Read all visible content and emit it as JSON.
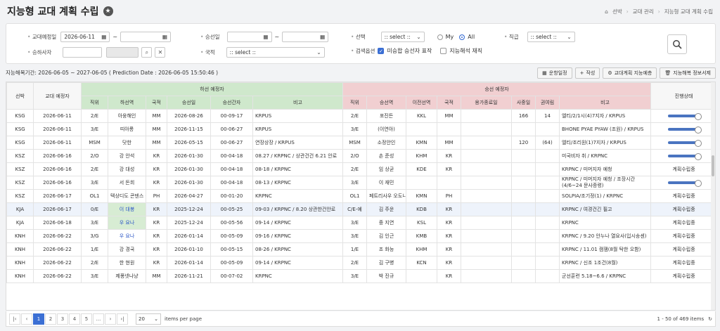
{
  "page": {
    "title": "지능형 교대 계획 수립",
    "breadcrumb": [
      "선박",
      "교대 관리",
      "지능형 교대 계획 수립"
    ]
  },
  "filter": {
    "plan_date_label": "교대예정일",
    "plan_date_from": "2026-06-11",
    "plan_date_to": "",
    "boarding_port_label": "승선일",
    "boarding_from": "",
    "boarding_to": "",
    "select_label": "선택",
    "select_value": ":: select ::",
    "radio_my": "My",
    "radio_all": "All",
    "rank_label": "직급",
    "rank_value": ":: select ::",
    "crew_label": "승하사자",
    "crew_value": "",
    "crew_value2": "",
    "nation_label": "국적",
    "nation_value": ":: select ::",
    "exclude_label": "검색옵션",
    "opt1": "미승합 승선자 표작",
    "opt2": "지능해석 재직"
  },
  "info": {
    "period": "지능해복기간: 2026-06-05 ~ 2027-06-05 ( Prediction Date : 2026-06-05 15:50:46 )"
  },
  "toolbar": {
    "btn1": "운항일정",
    "btn2": "작성",
    "btn3": "교대계획 지능예층",
    "btn4": "지능해복 정보서제"
  },
  "grid": {
    "h_select": "선박",
    "h_date": "교대 예정자",
    "h_off": "하선 예정자",
    "h_on": "승선 예정자",
    "h_status": "진행상태",
    "off_cols": [
      "직위",
      "하선역",
      "국적",
      "승선일",
      "승선간자",
      "비고"
    ],
    "on_cols": [
      "직위",
      "승선역",
      "이전선역",
      "국적",
      "용가종료일",
      "사중일",
      "권여림",
      "비고"
    ],
    "rows": [
      {
        "v": "KSG",
        "d": "2026-06-11",
        "r": "2/E",
        "n": "아웅해인",
        "c": "MM",
        "b": "2026-08-26",
        "p": "00-09-17",
        "note": "KRPUS",
        "r2": "2/E",
        "n2": "포진든",
        "pv": "KKL",
        "c2": "MM",
        "end": "",
        "s": "166",
        "k": "14",
        "note2": "엘티/2/1시(4)7지자 / KRPUS",
        "st": "bar"
      },
      {
        "v": "KSG",
        "d": "2026-06-11",
        "r": "3/E",
        "n": "띠아롱",
        "c": "MM",
        "b": "2026-11-15",
        "p": "00-06-27",
        "note": "KRPUS",
        "r2": "3/E",
        "n2": "(이연아)",
        "pv": "",
        "c2": "",
        "end": "",
        "s": "",
        "k": "",
        "note2": "BHONE PYAE PYAW (조원) / KRPUS",
        "st": "bar"
      },
      {
        "v": "KSG",
        "d": "2026-06-11",
        "r": "MSM",
        "n": "닷한",
        "c": "MM",
        "b": "2026-05-15",
        "p": "00-06-27",
        "note": "연장상장 / KRPUS",
        "r2": "MSM",
        "n2": "소정안인",
        "pv": "KMN",
        "c2": "MM",
        "end": "",
        "s": "120",
        "k": "(64)",
        "note2": "엘티/조리원(1)7지자 / KRPUS",
        "st": "bar"
      },
      {
        "v": "KSZ",
        "d": "2026-06-16",
        "r": "2/O",
        "n": "강 안석",
        "c": "KR",
        "b": "2026-01-30",
        "p": "00-04-18",
        "note": "08.27 / KRPNC / 상관건건 6.21 안로",
        "r2": "2/O",
        "n2": "손 준성",
        "pv": "KHM",
        "c2": "KR",
        "end": "",
        "s": "",
        "k": "",
        "note2": "미국비자 취 / KRPNC",
        "st": "bar"
      },
      {
        "v": "KSZ",
        "d": "2026-06-16",
        "r": "2/E",
        "n": "강 대성",
        "c": "KR",
        "b": "2026-01-30",
        "p": "00-04-18",
        "note": "08-18 / KRPNC",
        "r2": "2/E",
        "n2": "임 상균",
        "pv": "KDE",
        "c2": "KR",
        "end": "",
        "s": "",
        "k": "",
        "note2": "KRPNC / 미머지자 예청",
        "st": "계획수립중"
      },
      {
        "v": "KSZ",
        "d": "2026-06-16",
        "r": "3/E",
        "n": "서 돈희",
        "c": "KR",
        "b": "2026-01-30",
        "p": "00-04-18",
        "note": "08-13 / KRPNC",
        "r2": "3/E",
        "n2": "이 재민",
        "pv": "",
        "c2": "",
        "end": "",
        "s": "",
        "k": "",
        "note2": "KRPNC / 미머지자 예청 / 조장시간 (4/6~24 문사증령)",
        "st": "bar"
      },
      {
        "v": "KSZ",
        "d": "2026-06-17",
        "r": "OL1",
        "n": "텍상디도 콘덴스 에스세호",
        "c": "PH",
        "b": "2026-04-27",
        "p": "00-01-20",
        "note": "KRPNC",
        "r2": "OL1",
        "n2": "페트리사우 오도니 드 머린",
        "pv": "KMN",
        "c2": "PH",
        "end": "",
        "s": "",
        "k": "",
        "note2": "SOLPIA/조기정(1) / KRPNC",
        "st": "계획수립중"
      },
      {
        "v": "KJA",
        "d": "2026-06-17",
        "r": "0/E",
        "n": "이 대봉",
        "c": "KR",
        "b": "2025-12-24",
        "p": "00-05-25",
        "note": "09-03 / KRPNC / 8.20 상관한건안로",
        "r2": "C/E-예",
        "n2": "김 주운",
        "pv": "KDB",
        "c2": "KR",
        "end": "",
        "s": "",
        "k": "",
        "note2": "KRPNC / 여경건긴 필고",
        "st": "계획수립중"
      },
      {
        "v": "KJA",
        "d": "2026-06-18",
        "r": "3/E",
        "n": "우 요나",
        "c": "KR",
        "b": "2025-12-24",
        "p": "00-05-56",
        "note": "09-14 / KRPNC",
        "r2": "3/E",
        "n2": "중 지연",
        "pv": "KSL",
        "c2": "KR",
        "end": "",
        "s": "",
        "k": "",
        "note2": "KRPNC",
        "st": "계획수립중"
      },
      {
        "v": "KNH",
        "d": "2026-06-22",
        "r": "3/G",
        "n": "우 요나",
        "c": "KR",
        "b": "2026-01-14",
        "p": "00-05-09",
        "note": "09-16 / KRPNC",
        "r2": "3/E",
        "n2": "김 인근",
        "pv": "KMB",
        "c2": "KR",
        "end": "",
        "s": "",
        "k": "",
        "note2": "KRPNC / 9.20 안누나 열요사(입시송센)",
        "st": "계획수립중"
      },
      {
        "v": "KNH",
        "d": "2026-06-22",
        "r": "1/E",
        "n": "강 경국",
        "c": "KR",
        "b": "2026-01-10",
        "p": "00-05-15",
        "note": "08-26 / KRPNC",
        "r2": "1/E",
        "n2": "조 화능",
        "pv": "KHM",
        "c2": "KR",
        "end": "",
        "s": "",
        "k": "",
        "note2": "KRPNC / 11.01 캠잼(8월 탁한 오함)",
        "st": "계획수립중"
      },
      {
        "v": "KNH",
        "d": "2026-06-22",
        "r": "2/E",
        "n": "한 현원",
        "c": "KR",
        "b": "2026-01-14",
        "p": "00-05-09",
        "note": "09-14 / KRPNC",
        "r2": "2/E",
        "n2": "김 구병",
        "pv": "KCN",
        "c2": "KR",
        "end": "",
        "s": "",
        "k": "",
        "note2": "KRPNC / 신조 1조건(8월)",
        "st": "계획수립중"
      },
      {
        "v": "KNH",
        "d": "2026-06-22",
        "r": "3/E",
        "n": "제퐁넷나냥",
        "c": "MM",
        "b": "2026-11-21",
        "p": "00-07-02",
        "note": "KRPNC",
        "r2": "3/E",
        "n2": "박 진규",
        "pv": "",
        "c2": "KR",
        "end": "",
        "s": "",
        "k": "",
        "note2": "군선훈련 5.18~6.6 / KRPNC",
        "st": "계획수립중"
      }
    ]
  },
  "pager": {
    "pages": [
      "1",
      "2",
      "3",
      "4",
      "5",
      "..."
    ],
    "size": "20",
    "size_label": "items per page",
    "info": "1 - 50 of 469 items"
  },
  "colors": {
    "accent": "#3b6fd4",
    "off_header": "#cfe8cc",
    "on_header": "#f1cfd1"
  }
}
